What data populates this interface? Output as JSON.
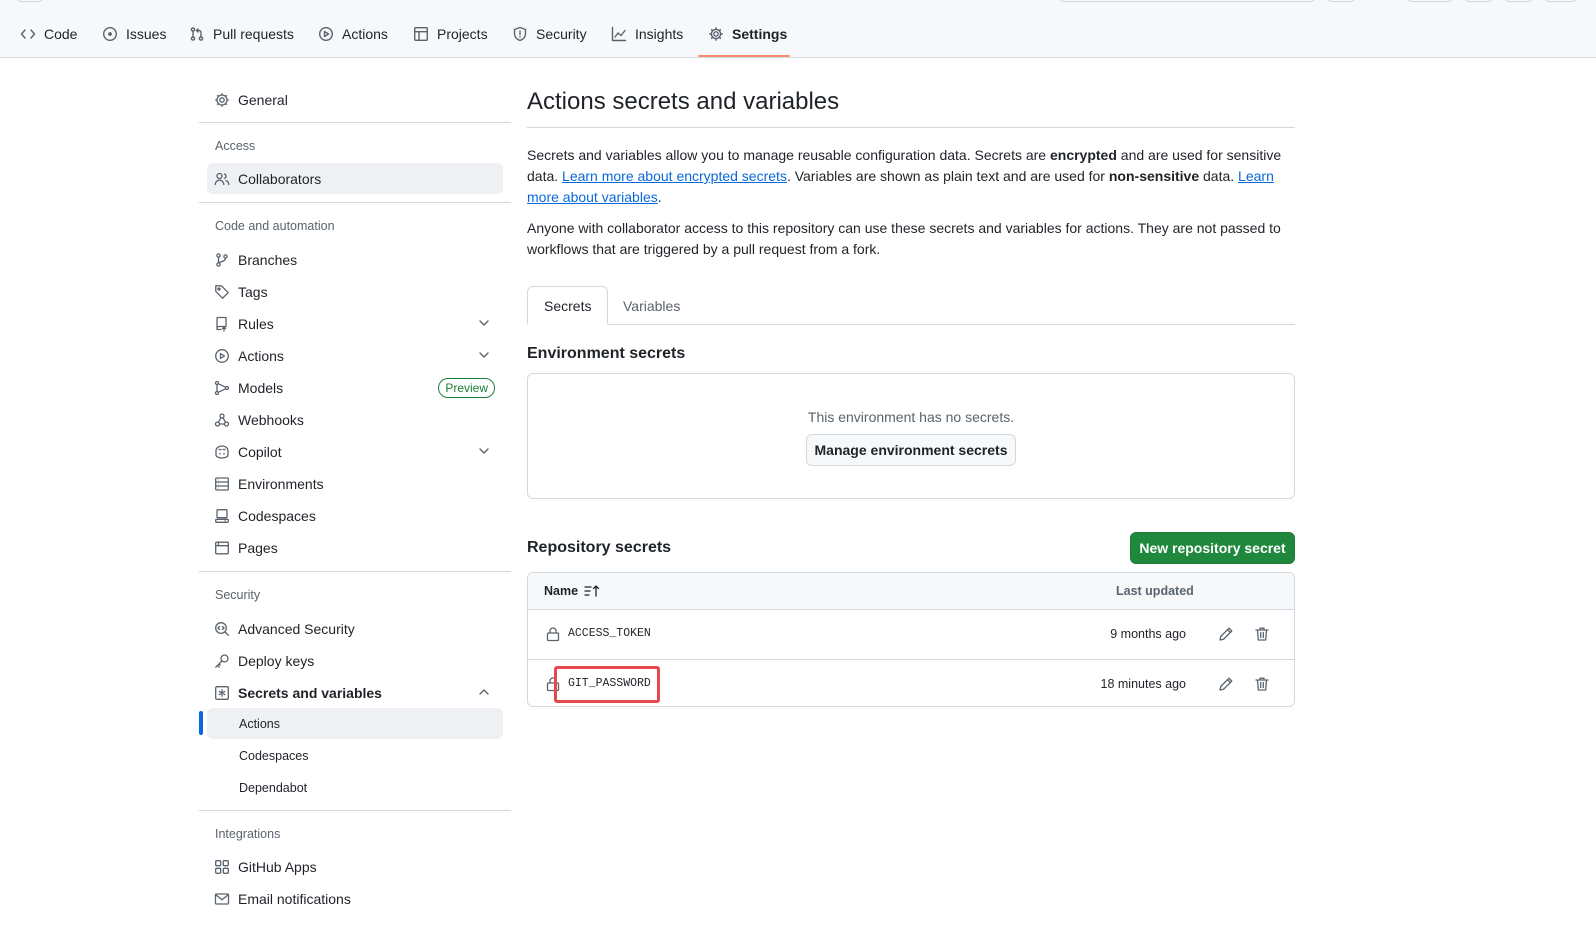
{
  "repo_nav": {
    "tabs": [
      {
        "label": "Code",
        "icon": "code-icon"
      },
      {
        "label": "Issues",
        "icon": "issue-opened-icon"
      },
      {
        "label": "Pull requests",
        "icon": "git-pull-request-icon"
      },
      {
        "label": "Actions",
        "icon": "play-icon"
      },
      {
        "label": "Projects",
        "icon": "table-icon"
      },
      {
        "label": "Security",
        "icon": "shield-icon"
      },
      {
        "label": "Insights",
        "icon": "graph-icon"
      },
      {
        "label": "Settings",
        "icon": "gear-icon",
        "active": true
      }
    ],
    "active_underline_color": "#fd8c73"
  },
  "sidebar": {
    "general": "General",
    "access_heading": "Access",
    "collaborators": "Collaborators",
    "code_automation_heading": "Code and automation",
    "branches": "Branches",
    "tags": "Tags",
    "rules": "Rules",
    "actions": "Actions",
    "models": "Models",
    "models_badge": "Preview",
    "webhooks": "Webhooks",
    "copilot": "Copilot",
    "environments": "Environments",
    "codespaces": "Codespaces",
    "pages": "Pages",
    "security_heading": "Security",
    "advanced_security": "Advanced Security",
    "deploy_keys": "Deploy keys",
    "secrets_and_variables": "Secrets and variables",
    "secrets_sub": {
      "actions": "Actions",
      "codespaces": "Codespaces",
      "dependabot": "Dependabot"
    },
    "integrations_heading": "Integrations",
    "github_apps": "GitHub Apps",
    "email_notifications": "Email notifications"
  },
  "main": {
    "title": "Actions secrets and variables",
    "intro": {
      "t1": "Secrets and variables allow you to manage reusable configuration data. Secrets are ",
      "b1": "encrypted",
      "t2": " and are used for sensitive data. ",
      "link1": "Learn more about encrypted secrets",
      "t3": ". Variables are shown as plain text and are used for ",
      "b2": "non-sensitive",
      "t4": " data. ",
      "link2": "Learn more about variables",
      "t5": "."
    },
    "note": "Anyone with collaborator access to this repository can use these secrets and variables for actions. They are not passed to workflows that are triggered by a pull request from a fork.",
    "tabs": [
      "Secrets",
      "Variables"
    ],
    "environment_secrets": {
      "title": "Environment secrets",
      "empty_message": "This environment has no secrets.",
      "manage_button": "Manage environment secrets"
    },
    "repository_secrets": {
      "title": "Repository secrets",
      "new_button": "New repository secret",
      "columns": {
        "name": "Name",
        "last_updated": "Last updated"
      },
      "rows": [
        {
          "name": "ACCESS_TOKEN",
          "updated": "9 months ago"
        },
        {
          "name": "GIT_PASSWORD",
          "updated": "18 minutes ago",
          "highlighted": true
        }
      ]
    }
  },
  "colors": {
    "link": "#0969da",
    "primary_button": "#1f883d",
    "selected_indicator": "#0969da",
    "highlight_box": "#e5484d",
    "preview_badge": "#1a7f37"
  }
}
